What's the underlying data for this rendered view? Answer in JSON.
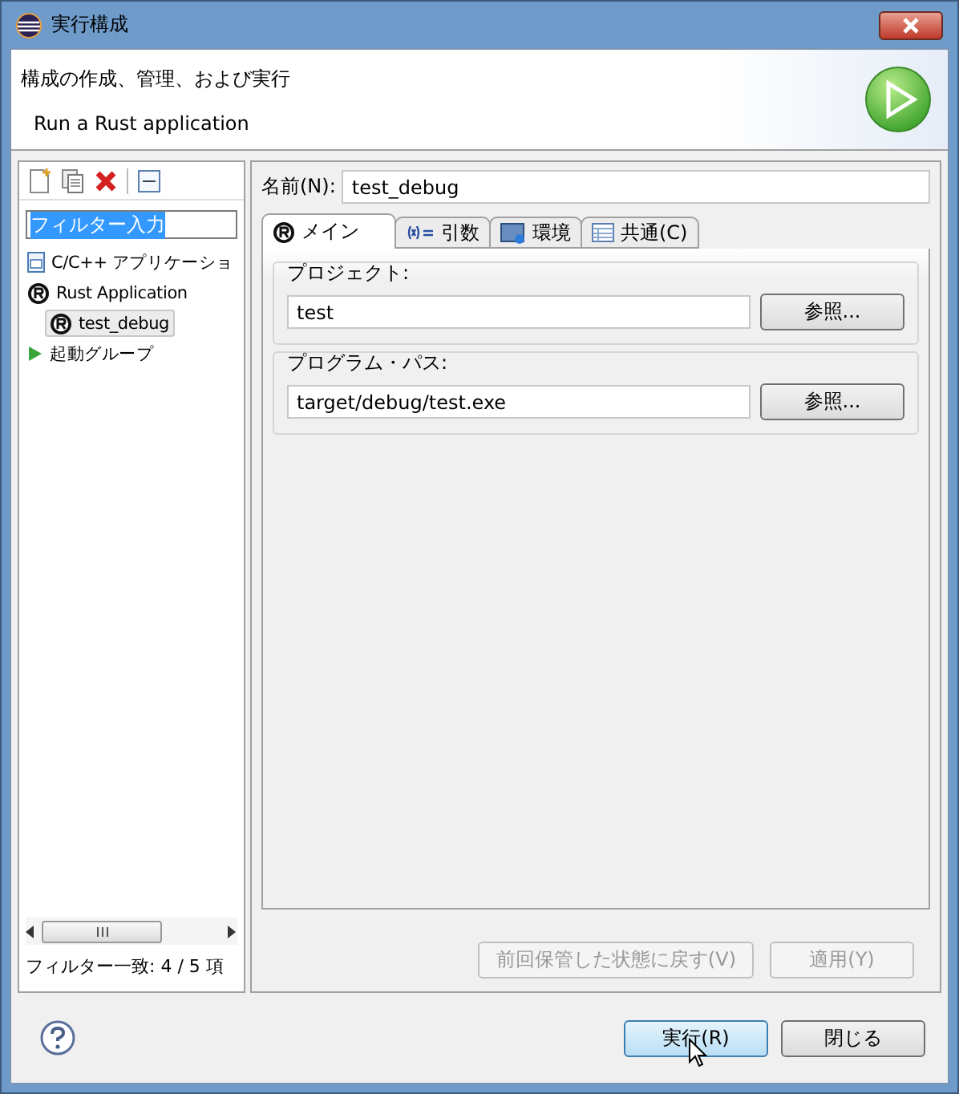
{
  "window": {
    "title": "実行構成"
  },
  "header": {
    "title": "構成の作成、管理、および実行",
    "message": "Run a Rust application"
  },
  "sidebar": {
    "filter": {
      "value": "フィルター入力",
      "selected": true
    },
    "tree": [
      {
        "label": "C/C++ アプリケーショ",
        "kind": "cpp",
        "selected": false
      },
      {
        "label": "Rust Application",
        "kind": "rust",
        "selected": false,
        "children": [
          {
            "label": "test_debug",
            "kind": "rust",
            "selected": true
          }
        ]
      },
      {
        "label": "起動グループ",
        "kind": "launch",
        "selected": false
      }
    ],
    "status": "フィルター一致: 4 / 5 項"
  },
  "form": {
    "name_label": "名前(N):",
    "name": "test_debug",
    "tabs": [
      {
        "label": "メイン",
        "kind": "rust",
        "selected": true
      },
      {
        "label": "引数",
        "kind": "args",
        "selected": false
      },
      {
        "label": "環境",
        "kind": "env",
        "selected": false
      },
      {
        "label": "共通(C)",
        "kind": "common",
        "selected": false
      }
    ],
    "groups": [
      {
        "label": "プロジェクト:",
        "value": "test",
        "button": "参照..."
      },
      {
        "label": "プログラム・パス:",
        "value": "target/debug/test.exe",
        "button": "参照..."
      }
    ],
    "buttons": [
      {
        "label": "前回保管した状態に戻す(V)",
        "disabled": true
      },
      {
        "label": "適用(Y)",
        "disabled": true
      }
    ]
  },
  "footer": {
    "buttons": [
      {
        "label": "実行(R)",
        "default": true
      },
      {
        "label": "閉じる",
        "default": false
      }
    ]
  }
}
